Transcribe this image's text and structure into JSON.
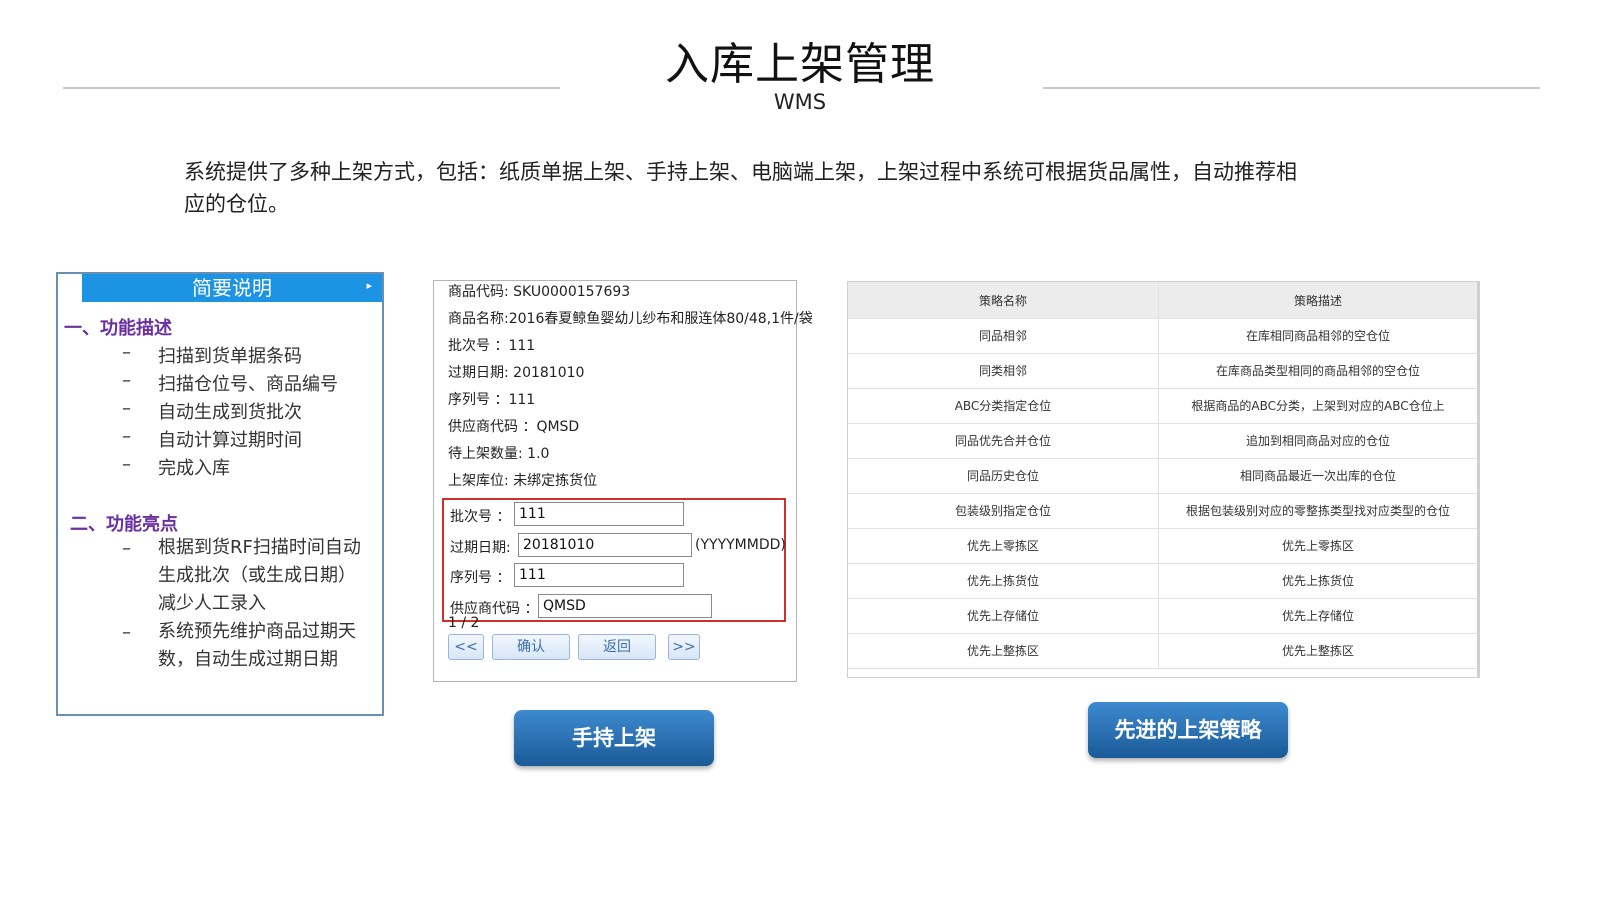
{
  "header": {
    "title": "入库上架管理",
    "subtitle": "WMS"
  },
  "intro": {
    "line1": "系统提供了多种上架方式，包括：纸质单据上架、手持上架、电脑端上架，上架过程中系统可根据货品属性，自动推荐相",
    "line2": "应的仓位。"
  },
  "summary": {
    "title": "简要说明",
    "section1": {
      "title": "一、功能描述",
      "items": [
        "扫描到货单据条码",
        "扫描仓位号、商品编号",
        "自动生成到货批次",
        "自动计算过期时间",
        "完成入库"
      ]
    },
    "section2": {
      "title": "二、功能亮点",
      "items": [
        [
          "根据到货RF扫描时间自动",
          "生成批次（或生成日期）",
          "减少人工录入"
        ],
        [
          "系统预先维护商品过期天",
          "数，自动生成过期日期"
        ]
      ]
    },
    "dash": "–"
  },
  "handheld": {
    "info": [
      "商品代码: SKU0000157693",
      "商品名称:2016春夏鲸鱼婴幼儿纱布和服连体80/48,1件/袋",
      "批次号 ：111",
      "过期日期: 20181010",
      "序列号 ：111",
      "供应商代码 ：QMSD",
      "待上架数量: 1.0",
      "上架库位: 未绑定拣货位"
    ],
    "fields": {
      "batch_label": "批次号 ：",
      "batch_value": "111",
      "expiry_label": "过期日期:",
      "expiry_value": "20181010",
      "expiry_hint": "(YYYYMMDD)",
      "serial_label": "序列号 ：",
      "serial_value": "111",
      "supplier_label": "供应商代码 ：",
      "supplier_value": "QMSD"
    },
    "page": "1 / 2",
    "buttons": {
      "prev": "<<",
      "confirm": "确认",
      "back": "返回",
      "next": ">>"
    },
    "caption": "手持上架"
  },
  "strategy": {
    "headers": [
      "策略名称",
      "策略描述"
    ],
    "rows": [
      [
        "同品相邻",
        "在库相同商品相邻的空仓位"
      ],
      [
        "同类相邻",
        "在库商品类型相同的商品相邻的空仓位"
      ],
      [
        "ABC分类指定仓位",
        "根据商品的ABC分类，上架到对应的ABC仓位上"
      ],
      [
        "同品优先合并仓位",
        "追加到相同商品对应的仓位"
      ],
      [
        "同品历史仓位",
        "相同商品最近一次出库的仓位"
      ],
      [
        "包装级别指定仓位",
        "根据包装级别对应的零整拣类型找对应类型的仓位"
      ],
      [
        "优先上零拣区",
        "优先上零拣区"
      ],
      [
        "优先上拣货位",
        "优先上拣货位"
      ],
      [
        "优先上存储位",
        "优先上存储位"
      ],
      [
        "优先上整拣区",
        "优先上整拣区"
      ]
    ],
    "caption": "先进的上架策略"
  }
}
